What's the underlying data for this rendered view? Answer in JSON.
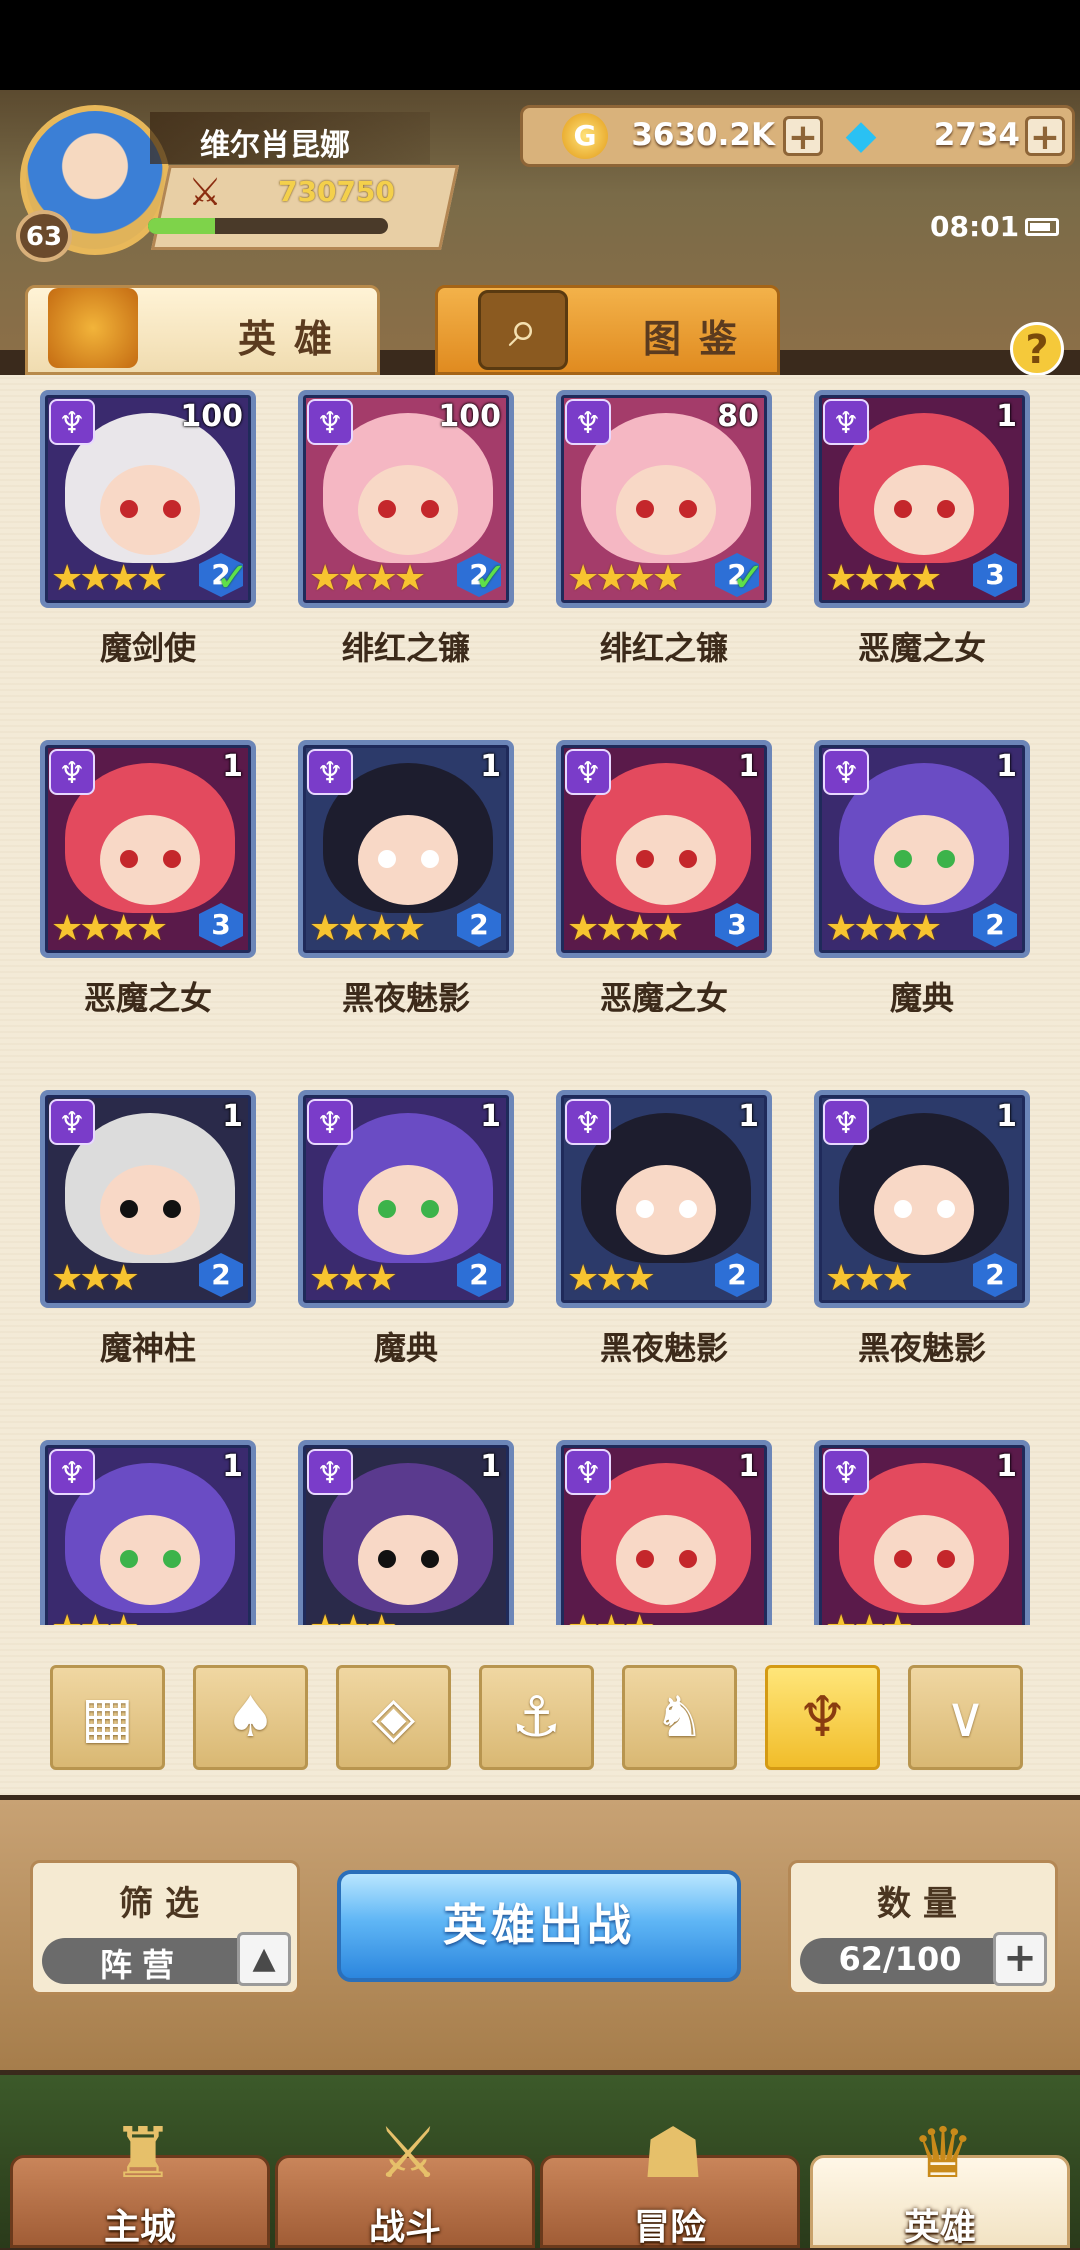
{
  "player": {
    "name": "维尔肖昆娜",
    "level": "63",
    "power": "730750",
    "exp_fraction": 0.28
  },
  "resources": {
    "gold": "3630.2K",
    "gems": "2734",
    "gold_icon_letter": "G"
  },
  "status": {
    "time": "08:01"
  },
  "tabs": [
    {
      "label": "英雄",
      "active": true
    },
    {
      "label": "图鉴",
      "active": false
    }
  ],
  "help_label": "?",
  "heroes": [
    {
      "name": "魔剑使",
      "level": "100",
      "stars": 4,
      "tier": "2",
      "checked": true,
      "hair": "#e9e6ea",
      "bg": "#3a2a6e",
      "eye": "#c4272b"
    },
    {
      "name": "绯红之镰",
      "level": "100",
      "stars": 4,
      "tier": "2",
      "checked": true,
      "hair": "#f5b7c3",
      "bg": "#a43c6a",
      "eye": "#c4272b"
    },
    {
      "name": "绯红之镰",
      "level": "80",
      "stars": 4,
      "tier": "2",
      "checked": true,
      "hair": "#f5b7c3",
      "bg": "#a43c6a",
      "eye": "#c4272b"
    },
    {
      "name": "恶魔之女",
      "level": "1",
      "stars": 4,
      "tier": "3",
      "checked": false,
      "hair": "#e34a5e",
      "bg": "#5a1a4a",
      "eye": "#c4272b"
    },
    {
      "name": "恶魔之女",
      "level": "1",
      "stars": 4,
      "tier": "3",
      "checked": false,
      "hair": "#e34a5e",
      "bg": "#5a1a4a",
      "eye": "#c4272b"
    },
    {
      "name": "黑夜魅影",
      "level": "1",
      "stars": 4,
      "tier": "2",
      "checked": false,
      "hair": "#1d1d2e",
      "bg": "#2c3a6a",
      "eye": "#ffffff"
    },
    {
      "name": "恶魔之女",
      "level": "1",
      "stars": 4,
      "tier": "3",
      "checked": false,
      "hair": "#e34a5e",
      "bg": "#5a1a4a",
      "eye": "#c4272b"
    },
    {
      "name": "魔典",
      "level": "1",
      "stars": 4,
      "tier": "2",
      "checked": false,
      "hair": "#6a4cc4",
      "bg": "#3a2a6e",
      "eye": "#3cb34a"
    },
    {
      "name": "魔神柱",
      "level": "1",
      "stars": 3,
      "tier": "2",
      "checked": false,
      "hair": "#dcdcdc",
      "bg": "#2a2a4a",
      "eye": "#111111"
    },
    {
      "name": "魔典",
      "level": "1",
      "stars": 3,
      "tier": "2",
      "checked": false,
      "hair": "#6a4cc4",
      "bg": "#3a2a6e",
      "eye": "#3cb34a"
    },
    {
      "name": "黑夜魅影",
      "level": "1",
      "stars": 3,
      "tier": "2",
      "checked": false,
      "hair": "#1d1d2e",
      "bg": "#2c3a6a",
      "eye": "#ffffff"
    },
    {
      "name": "黑夜魅影",
      "level": "1",
      "stars": 3,
      "tier": "2",
      "checked": false,
      "hair": "#1d1d2e",
      "bg": "#2c3a6a",
      "eye": "#ffffff"
    },
    {
      "name": "",
      "level": "1",
      "stars": 3,
      "tier": "",
      "checked": false,
      "hair": "#6a4cc4",
      "bg": "#3a2a6e",
      "eye": "#3cb34a"
    },
    {
      "name": "",
      "level": "1",
      "stars": 3,
      "tier": "",
      "checked": false,
      "hair": "#5a3a8e",
      "bg": "#2a2a4a",
      "eye": "#111111"
    },
    {
      "name": "",
      "level": "1",
      "stars": 3,
      "tier": "",
      "checked": false,
      "hair": "#e34a5e",
      "bg": "#5a1a4a",
      "eye": "#c4272b"
    },
    {
      "name": "",
      "level": "1",
      "stars": 3,
      "tier": "",
      "checked": false,
      "hair": "#e34a5e",
      "bg": "#5a1a4a",
      "eye": "#c4272b"
    }
  ],
  "faction_filters": [
    {
      "icon": "all-grid-icon",
      "glyph": "▦",
      "active": false
    },
    {
      "icon": "forest-faction-icon",
      "glyph": "♠",
      "active": false
    },
    {
      "icon": "fortress-faction-icon",
      "glyph": "◈",
      "active": false
    },
    {
      "icon": "anchor-faction-icon",
      "glyph": "⚓",
      "active": false
    },
    {
      "icon": "beast-faction-icon",
      "glyph": "♞",
      "active": false
    },
    {
      "icon": "demon-faction-icon",
      "glyph": "♆",
      "active": true
    },
    {
      "icon": "wing-faction-icon",
      "glyph": "∨",
      "active": false
    }
  ],
  "filter": {
    "label": "筛选",
    "value": "阵营",
    "button": "▲"
  },
  "deploy": {
    "label": "英雄出战"
  },
  "count": {
    "label": "数量",
    "value": "62/100",
    "button": "+"
  },
  "nav": [
    {
      "label": "主城",
      "icon": "castle-icon",
      "glyph": "♜",
      "active": false
    },
    {
      "label": "战斗",
      "icon": "crossed-swords-icon",
      "glyph": "⚔",
      "active": false
    },
    {
      "label": "冒险",
      "icon": "map-scroll-icon",
      "glyph": "☗",
      "active": false
    },
    {
      "label": "英雄",
      "icon": "hero-helmet-icon",
      "glyph": "♛",
      "active": true
    }
  ]
}
